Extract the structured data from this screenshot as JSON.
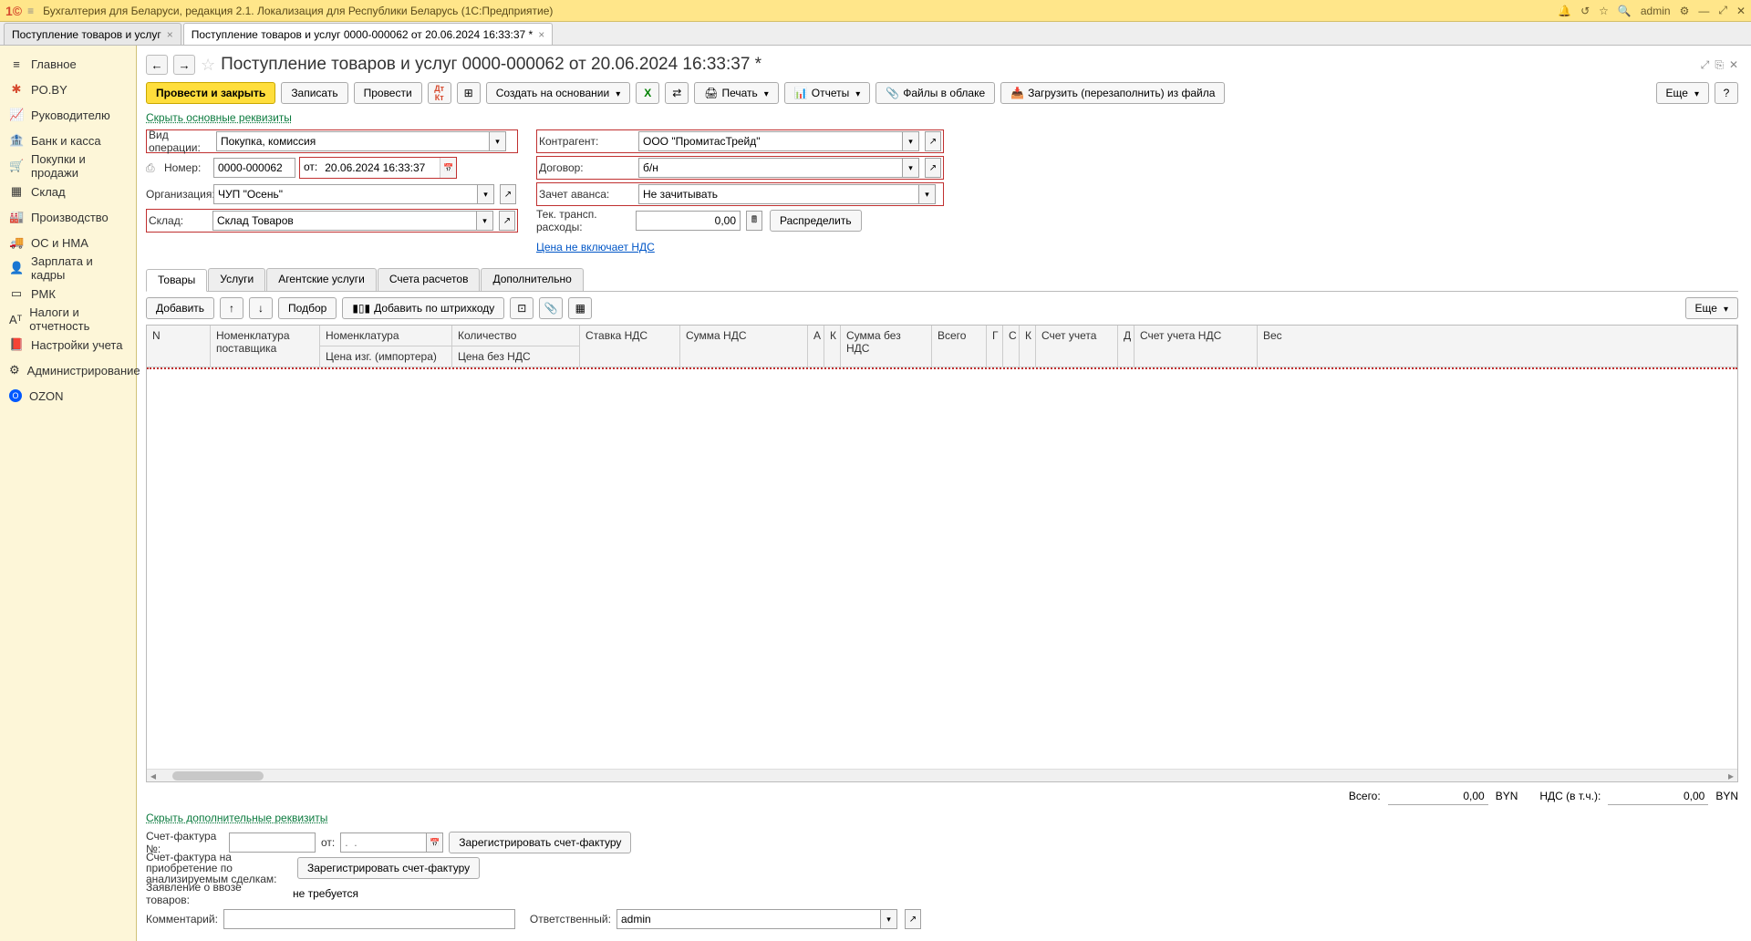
{
  "titlebar": {
    "title": "Бухгалтерия для Беларуси, редакция 2.1. Локализация для Республики Беларусь   (1С:Предприятие)",
    "user": "admin"
  },
  "tabs": [
    {
      "label": "Поступление товаров и услуг",
      "active": false
    },
    {
      "label": "Поступление товаров и услуг 0000-000062 от 20.06.2024 16:33:37 *",
      "active": true
    }
  ],
  "sidebar": {
    "items": [
      {
        "icon": "≡",
        "label": "Главное"
      },
      {
        "icon": "✱",
        "label": "PO.BY",
        "color": "#d64a2e"
      },
      {
        "icon": "📈",
        "label": "Руководителю"
      },
      {
        "icon": "🏦",
        "label": "Банк и касса"
      },
      {
        "icon": "🛒",
        "label": "Покупки и продажи"
      },
      {
        "icon": "▦",
        "label": "Склад"
      },
      {
        "icon": "🏭",
        "label": "Производство"
      },
      {
        "icon": "🚚",
        "label": "ОС и НМА"
      },
      {
        "icon": "👤",
        "label": "Зарплата и кадры"
      },
      {
        "icon": "▭",
        "label": "РМК"
      },
      {
        "icon": "Аᵀ",
        "label": "Налоги и отчетность"
      },
      {
        "icon": "📕",
        "label": "Настройки учета"
      },
      {
        "icon": "⚙",
        "label": "Администрирование"
      },
      {
        "icon": "O",
        "label": "OZON",
        "color": "#0058ff"
      }
    ]
  },
  "page": {
    "title": "Поступление товаров и услуг 0000-000062 от 20.06.2024 16:33:37 *",
    "hide_main_link": "Скрыть основные реквизиты",
    "hide_extra_link": "Скрыть дополнительные реквизиты"
  },
  "toolbar": {
    "post_close": "Провести и закрыть",
    "save": "Записать",
    "post": "Провести",
    "create_based": "Создать на основании",
    "print": "Печать",
    "reports": "Отчеты",
    "cloud_files": "Файлы в облаке",
    "load_from_file": "Загрузить (перезаполнить) из файла",
    "more": "Еще"
  },
  "form": {
    "op_type_label": "Вид операции:",
    "op_type": "Покупка, комиссия",
    "number_label": "Номер:",
    "number": "0000-000062",
    "from_label": "от:",
    "date": "20.06.2024 16:33:37",
    "org_label": "Организация:",
    "org": "ЧУП \"Осень\"",
    "warehouse_label": "Склад:",
    "warehouse": "Склад Товаров",
    "counterparty_label": "Контрагент:",
    "counterparty": "ООО \"ПромитасТрейд\"",
    "contract_label": "Договор:",
    "contract": "б/н",
    "advance_label": "Зачет аванса:",
    "advance": "Не зачитывать",
    "transport_label": "Тек. трансп. расходы:",
    "transport_value": "0,00",
    "distribute": "Распределить",
    "price_link": "Цена не включает НДС"
  },
  "doc_tabs": [
    "Товары",
    "Услуги",
    "Агентские услуги",
    "Счета расчетов",
    "Дополнительно"
  ],
  "sub_toolbar": {
    "add": "Добавить",
    "pickup": "Подбор",
    "barcode": "Добавить по штрихкоду",
    "more": "Еще"
  },
  "table": {
    "columns": {
      "n": "N",
      "supplier_nom": "Номенклатура поставщика",
      "nom": "Номенклатура",
      "price_imp": "Цена изг. (импортера)",
      "qty": "Количество",
      "price_no_vat": "Цена без НДС",
      "vat_rate": "Ставка НДС",
      "vat_sum": "Сумма НДС",
      "a": "А",
      "k": "К",
      "sum_no_vat": "Сумма без НДС",
      "total": "Всего",
      "g": "Г",
      "c": "С",
      "k2": "К",
      "acc": "Счет учета",
      "d": "Д",
      "vat_acc": "Счет учета НДС",
      "weight": "Вес"
    }
  },
  "totals": {
    "total_label": "Всего:",
    "total_value": "0,00",
    "currency": "BYN",
    "vat_label": "НДС (в т.ч.):",
    "vat_value": "0,00"
  },
  "footer": {
    "invoice_no_label": "Счет-фактура №:",
    "invoice_from": "от:",
    "invoice_date_placeholder": ".  .",
    "register_invoice": "Зарегистрировать счет-фактуру",
    "invoice_purchase_label": "Счет-фактура на приобретение по анализируемым сделкам:",
    "import_decl_label": "Заявление о ввозе товаров:",
    "import_decl_value": "не требуется",
    "comment_label": "Комментарий:",
    "responsible_label": "Ответственный:",
    "responsible": "admin"
  }
}
